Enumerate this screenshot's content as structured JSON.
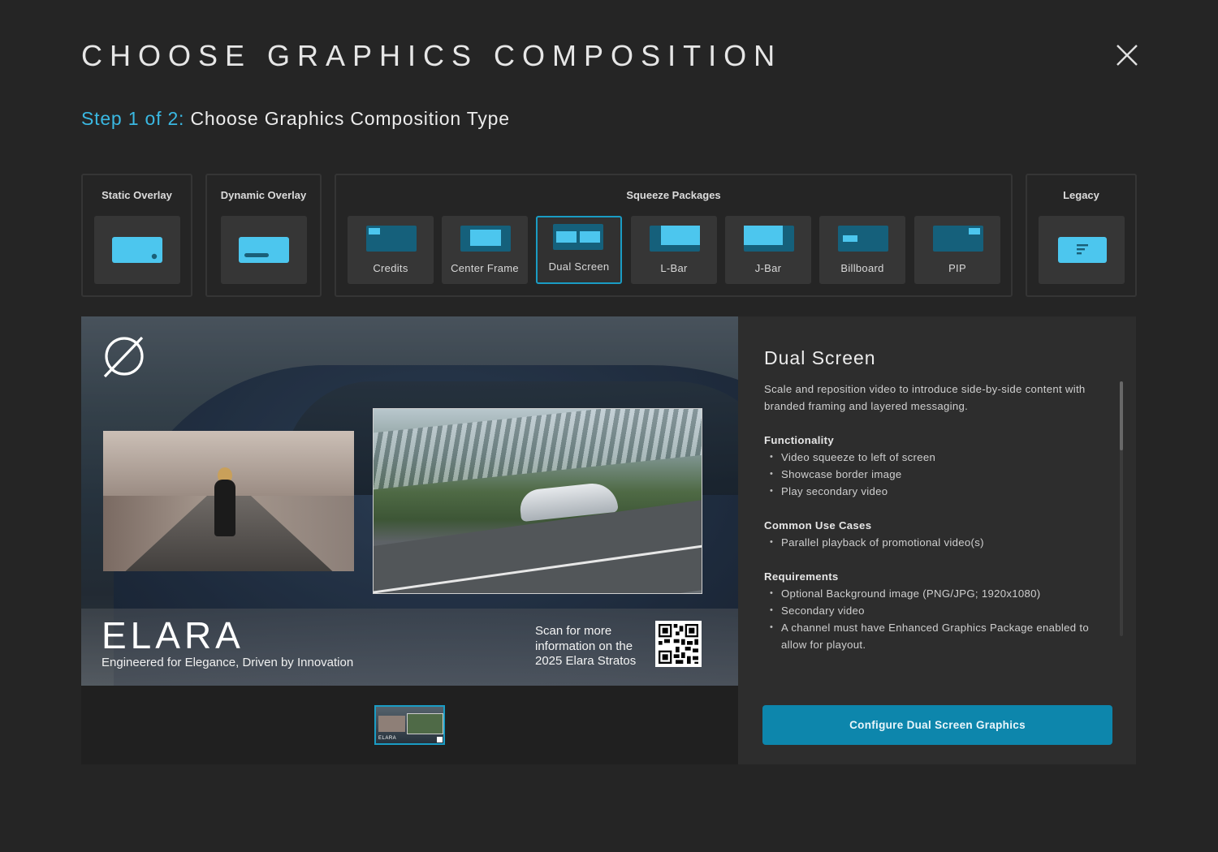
{
  "header": {
    "title": "CHOOSE GRAPHICS COMPOSITION",
    "close_icon": "close-icon"
  },
  "step": {
    "prefix": "Step 1 of 2:",
    "label": "Choose Graphics Composition Type"
  },
  "groups": {
    "static_overlay": {
      "label": "Static Overlay"
    },
    "dynamic_overlay": {
      "label": "Dynamic Overlay"
    },
    "squeeze_packages": {
      "label": "Squeeze Packages",
      "items": [
        {
          "label": "Credits",
          "icon": "credits-icon"
        },
        {
          "label": "Center Frame",
          "icon": "center-frame-icon"
        },
        {
          "label": "Dual Screen",
          "icon": "dual-screen-icon",
          "selected": true
        },
        {
          "label": "L-Bar",
          "icon": "l-bar-icon"
        },
        {
          "label": "J-Bar",
          "icon": "j-bar-icon"
        },
        {
          "label": "Billboard",
          "icon": "billboard-icon"
        },
        {
          "label": "PIP",
          "icon": "pip-icon"
        }
      ]
    },
    "legacy": {
      "label": "Legacy"
    }
  },
  "preview": {
    "brand": "ELARA",
    "tagline": "Engineered for Elegance, Driven by Innovation",
    "scan_text": "Scan for more information on the 2025 Elara Stratos",
    "thumb_brand": "ELARA"
  },
  "details": {
    "title": "Dual Screen",
    "description": "Scale and reposition video to introduce side-by-side content with branded framing and layered messaging.",
    "sections": [
      {
        "heading": "Functionality",
        "items": [
          "Video squeeze to left of screen",
          "Showcase border image",
          "Play secondary video"
        ]
      },
      {
        "heading": "Common Use Cases",
        "items": [
          "Parallel playback of promotional video(s)"
        ]
      },
      {
        "heading": "Requirements",
        "items": [
          "Optional Background image (PNG/JPG; 1920x1080)",
          "Secondary video",
          "A channel must have Enhanced Graphics Package enabled to allow for playout."
        ]
      }
    ],
    "cta_label": "Configure Dual Screen Graphics"
  },
  "colors": {
    "accent": "#3ab8e2",
    "icon_fill": "#4cc6ee",
    "icon_dark": "#1a5f78",
    "button": "#0d86ac",
    "background": "#252525"
  }
}
